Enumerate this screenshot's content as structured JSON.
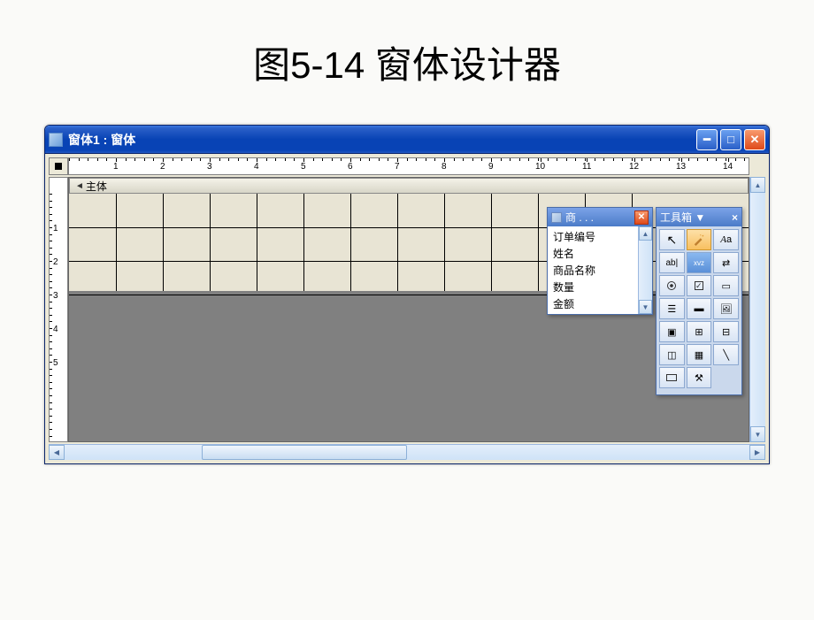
{
  "figure_title": "图5-14  窗体设计器",
  "window": {
    "title": "窗体1 : 窗体"
  },
  "detail_section_label": "主体",
  "ruler_marks": [
    "1",
    "2",
    "3",
    "4",
    "5",
    "6",
    "7",
    "8",
    "9",
    "10",
    "11",
    "12",
    "13",
    "14"
  ],
  "v_ruler_marks": [
    "1",
    "2",
    "3",
    "4",
    "5"
  ],
  "field_list": {
    "title": "商 . . .",
    "items": [
      "订单编号",
      "姓名",
      "商品名称",
      "数量",
      "金额"
    ]
  },
  "toolbox": {
    "title": "工具箱",
    "tools": [
      {
        "name": "pointer",
        "glyph": "↖",
        "selected": false
      },
      {
        "name": "wizard",
        "glyph": "✎",
        "selected": true
      },
      {
        "name": "label",
        "glyph": "Aa",
        "selected": false
      },
      {
        "name": "textbox",
        "glyph": "ab|",
        "selected": false
      },
      {
        "name": "blue-box",
        "glyph": "",
        "selected": false
      },
      {
        "name": "toggle",
        "glyph": "⇄",
        "selected": false
      },
      {
        "name": "option",
        "glyph": "◉",
        "selected": false
      },
      {
        "name": "checkbox",
        "glyph": "☑",
        "selected": false
      },
      {
        "name": "combo",
        "glyph": "▭",
        "selected": false
      },
      {
        "name": "listbox",
        "glyph": "☰",
        "selected": false
      },
      {
        "name": "button",
        "glyph": "▬",
        "selected": false
      },
      {
        "name": "image",
        "glyph": "🖼",
        "selected": false
      },
      {
        "name": "unbound",
        "glyph": "▣",
        "selected": false
      },
      {
        "name": "bound",
        "glyph": "⊞",
        "selected": false
      },
      {
        "name": "pagebreak",
        "glyph": "⊟",
        "selected": false
      },
      {
        "name": "tab",
        "glyph": "◫",
        "selected": false
      },
      {
        "name": "subform",
        "glyph": "▦",
        "selected": false
      },
      {
        "name": "line",
        "glyph": "╲",
        "selected": false
      },
      {
        "name": "rectangle",
        "glyph": "□",
        "selected": false
      },
      {
        "name": "more",
        "glyph": "⚒",
        "selected": false
      }
    ]
  }
}
